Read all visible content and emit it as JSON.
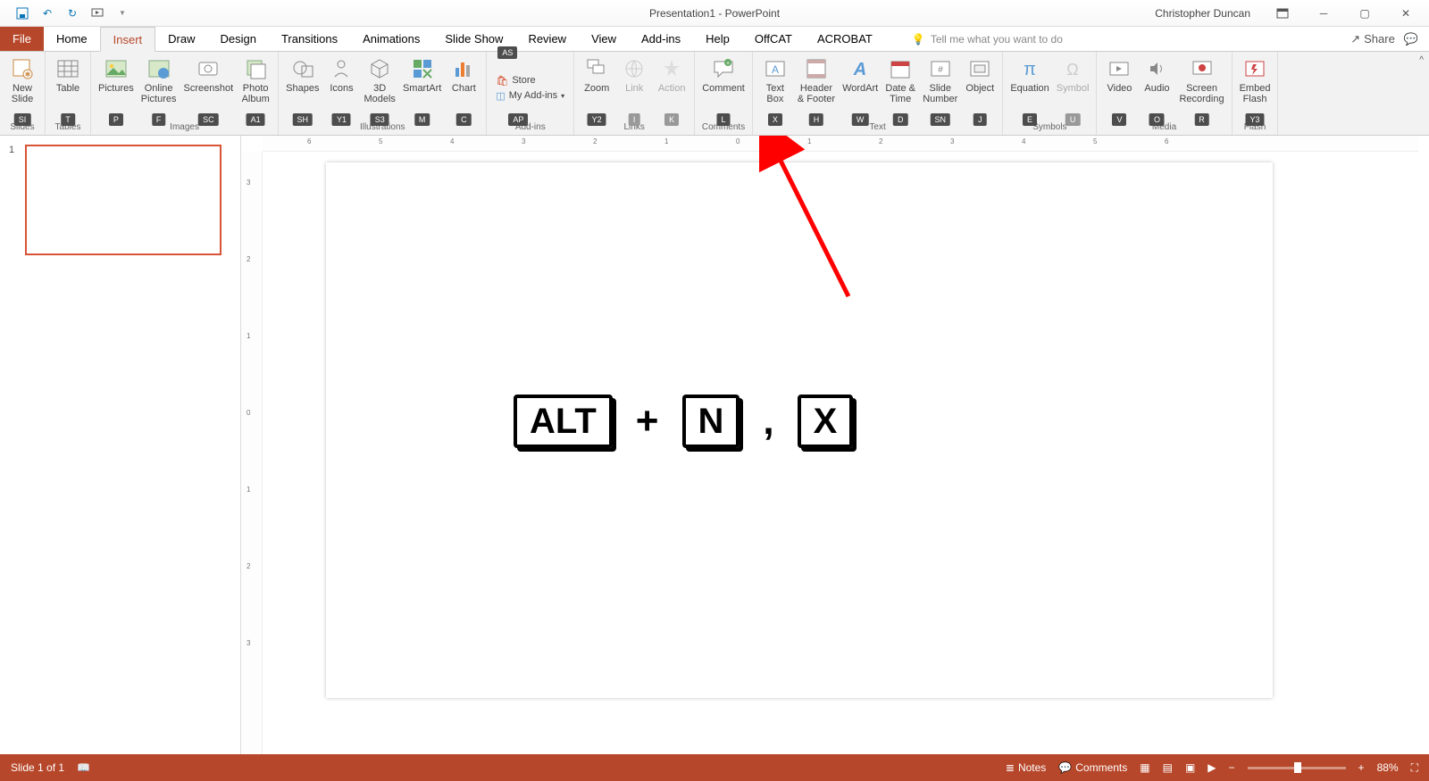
{
  "title": "Presentation1 - PowerPoint",
  "user": "Christopher Duncan",
  "tabs": [
    "File",
    "Home",
    "Insert",
    "Draw",
    "Design",
    "Transitions",
    "Animations",
    "Slide Show",
    "Review",
    "View",
    "Add-ins",
    "Help",
    "OffCAT",
    "ACROBAT"
  ],
  "active_tab": "Insert",
  "tellme_placeholder": "Tell me what you want to do",
  "share": "Share",
  "ribbon": {
    "new_slide": {
      "label": "New\nSlide",
      "key": "SI",
      "group": "Slides"
    },
    "table": {
      "label": "Table",
      "key": "T",
      "group": "Tables"
    },
    "pictures": {
      "label": "Pictures",
      "key": "P"
    },
    "online_pictures": {
      "label": "Online\nPictures",
      "key": "F"
    },
    "screenshot": {
      "label": "Screenshot",
      "key": "SC"
    },
    "photo_album": {
      "label": "Photo\nAlbum",
      "key": "A1"
    },
    "images_group": "Images",
    "shapes": {
      "label": "Shapes",
      "key": "SH"
    },
    "icons": {
      "label": "Icons",
      "key": "Y1"
    },
    "models3d": {
      "label": "3D\nModels",
      "key": "S3"
    },
    "smartart": {
      "label": "SmartArt",
      "key": "M"
    },
    "chart": {
      "label": "Chart",
      "key": "C"
    },
    "illustrations_group": "Illustrations",
    "store": {
      "label": "Store",
      "key": "AS"
    },
    "myaddins": {
      "label": "My Add-ins",
      "key": "AP"
    },
    "addins_group": "Add-ins",
    "zoom": {
      "label": "Zoom",
      "key": "Y2"
    },
    "link": {
      "label": "Link",
      "key": "I"
    },
    "action": {
      "label": "Action",
      "key": "K"
    },
    "links_group": "Links",
    "comment": {
      "label": "Comment",
      "key": "L"
    },
    "comments_group": "Comments",
    "textbox": {
      "label": "Text\nBox",
      "key": "X"
    },
    "header": {
      "label": "Header\n& Footer",
      "key": "H"
    },
    "wordart": {
      "label": "WordArt",
      "key": "W"
    },
    "datetime": {
      "label": "Date &\nTime",
      "key": "D"
    },
    "slidenum": {
      "label": "Slide\nNumber",
      "key": "SN"
    },
    "object": {
      "label": "Object",
      "key": "J"
    },
    "text_group": "Text",
    "equation": {
      "label": "Equation",
      "key": "E"
    },
    "symbol": {
      "label": "Symbol",
      "key": "U"
    },
    "symbols_group": "Symbols",
    "video": {
      "label": "Video",
      "key": "V"
    },
    "audio": {
      "label": "Audio",
      "key": "O"
    },
    "screenrec": {
      "label": "Screen\nRecording",
      "key": "R"
    },
    "media_group": "Media",
    "embed_flash": {
      "label": "Embed\nFlash",
      "key": "Y3"
    },
    "flash_group": "Flash"
  },
  "ruler_marks": [
    "6",
    "5",
    "4",
    "3",
    "2",
    "1",
    "0",
    "1",
    "2",
    "3",
    "4",
    "5",
    "6"
  ],
  "ruler_marks_v": [
    "3",
    "2",
    "1",
    "0",
    "1",
    "2",
    "3"
  ],
  "thumb_number": "1",
  "shortcut": {
    "k1": "ALT",
    "plus": "+",
    "k2": "N",
    "comma": ",",
    "k3": "X"
  },
  "status": {
    "slide_info": "Slide 1 of 1",
    "notes": "Notes",
    "comments": "Comments",
    "zoom_pct": "88%"
  }
}
